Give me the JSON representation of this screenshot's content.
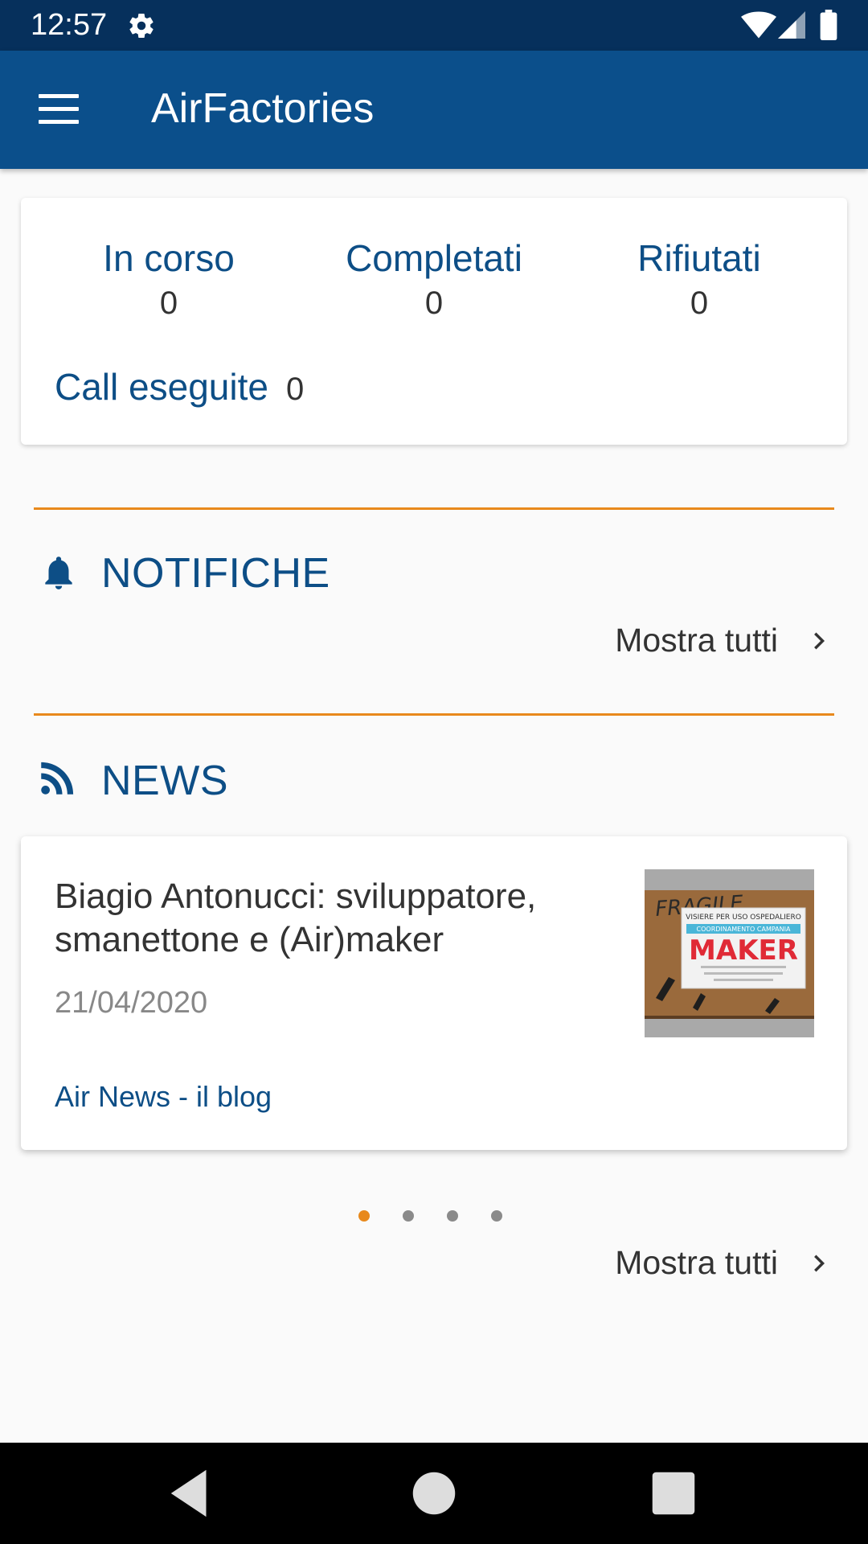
{
  "status_bar": {
    "time": "12:57",
    "icons": [
      "gear-icon",
      "wifi-icon",
      "signal-icon",
      "battery-icon"
    ]
  },
  "app_bar": {
    "title": "AirFactories",
    "menu_icon": "menu-icon",
    "background": "#0b4f8b"
  },
  "stats": {
    "in_progress": {
      "label": "In corso",
      "value": "0"
    },
    "completed": {
      "label": "Completati",
      "value": "0"
    },
    "rejected": {
      "label": "Rifiutati",
      "value": "0"
    },
    "calls": {
      "label": "Call eseguite",
      "value": "0"
    }
  },
  "notifications": {
    "title": "NOTIFICHE",
    "icon": "bell-icon",
    "show_all_label": "Mostra tutti"
  },
  "news": {
    "title": "NEWS",
    "icon": "rss-icon",
    "item": {
      "title": "Biagio Antonucci: sviluppatore, smanettone e (Air)maker",
      "date": "21/04/2020",
      "source": "Air News - il blog",
      "thumbnail": {
        "top_line": "VISIERE PER USO OSPEDALIERO",
        "banner": "COORDINAMENTO CAMPANIA",
        "headline": "MAKER",
        "scrawl": "FRAGILE"
      }
    },
    "pager": {
      "count": 4,
      "active_index": 0
    },
    "show_all_label": "Mostra tutti"
  },
  "colors": {
    "primary": "#0b4f8b",
    "status_bar": "#06305c",
    "accent": "#e8891c",
    "heading_text": "#0d4e86"
  },
  "nav_bar": {
    "buttons": [
      "back-icon",
      "home-icon",
      "recents-icon"
    ]
  }
}
